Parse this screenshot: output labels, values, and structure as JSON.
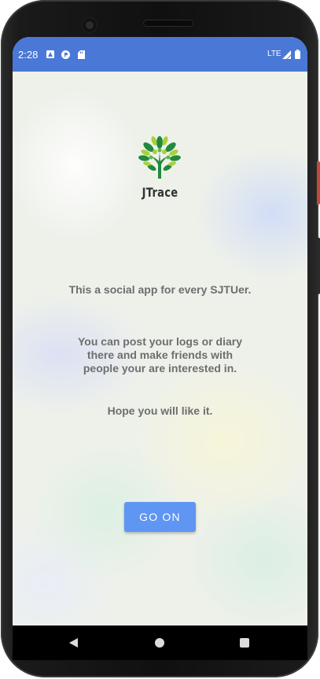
{
  "status_bar": {
    "time": "2:28",
    "network": "LTE"
  },
  "app": {
    "brand": "JTrace",
    "lines": [
      "This a social app for every SJTUer.",
      "You can post your logs or diary",
      "there and make friends with",
      "people your are interested in.",
      "Hope you will like it."
    ],
    "go_on_label": "GO ON"
  },
  "colors": {
    "status_bar": "#4a78d6",
    "button": "#5f95f3",
    "logo_dark_green": "#1f8a3c",
    "logo_light_green": "#a9d03a"
  },
  "icons": [
    "status-a-icon",
    "status-p-icon",
    "sd-card-icon",
    "signal-icon",
    "battery-icon",
    "tree-logo-icon",
    "back-icon",
    "home-icon",
    "recents-icon"
  ]
}
